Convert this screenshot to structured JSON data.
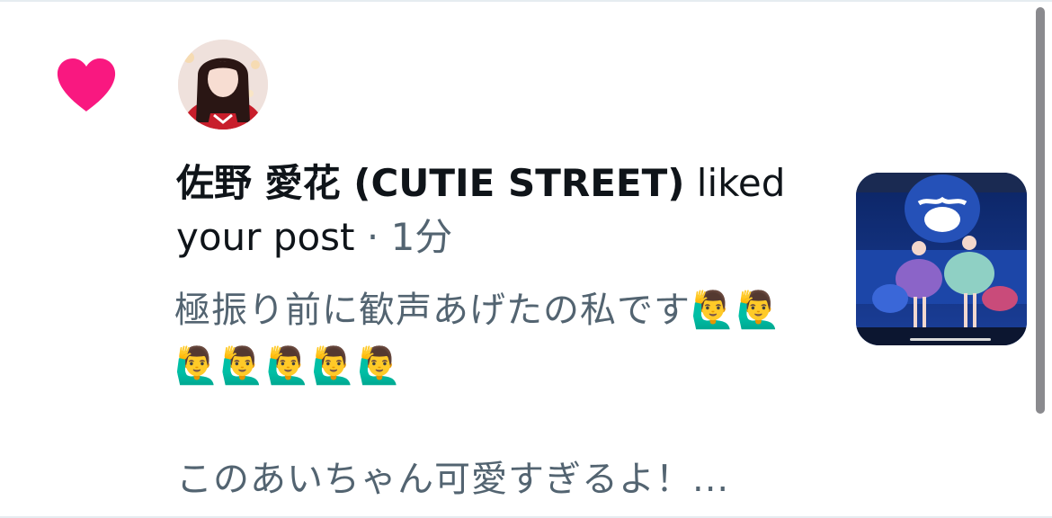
{
  "notification": {
    "type_icon": "heart-icon",
    "author": "佐野 愛花 (CUTIE STREET)",
    "action": " liked your post",
    "separator": " · ",
    "time": "1分",
    "post_text_line1": "極振り前に歓声あげたの私です🙋‍♂️🙋‍♂️🙋‍♂️🙋‍♂️🙋‍♂️🙋‍♂️🙋‍♂️",
    "post_text_line2": "このあいちゃん可愛すぎるよ！...",
    "accent_color": "#f91880",
    "text_color": "#0f1419",
    "muted_color": "#536471"
  }
}
